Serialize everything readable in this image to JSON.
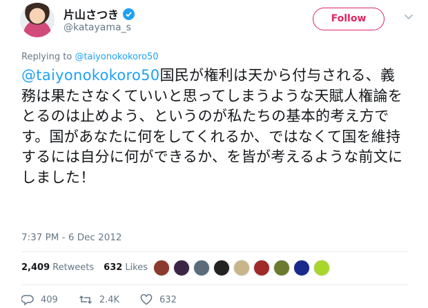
{
  "user": {
    "display_name": "片山さつき",
    "handle": "@katayama_s",
    "verified": true
  },
  "follow_button": {
    "label": "Follow",
    "color": "#e0245e"
  },
  "tweet": {
    "reply_prefix": "Replying to",
    "reply_to": "@taiyonokokoro50",
    "mention": "@taiyonokokoro50",
    "body": "国民が権利は天から付与される、義務は果たさなくていいと思ってしまうような天賦人権論をとるのは止めよう、というのが私たちの基本的考え方です。国があなたに何をしてくれるか、ではなくて国を維持するには自分に何ができるか、を皆が考えるような前文にしました！",
    "timestamp": "7:37 PM - 6 Dec 2012"
  },
  "stats": {
    "retweets_count": "2,409",
    "retweets_label": "Retweets",
    "likes_count": "632",
    "likes_label": "Likes"
  },
  "likers": [
    {
      "icon": "avatar-icon",
      "color": "#8b3a2e"
    },
    {
      "icon": "avatar-icon",
      "color": "#3b2545"
    },
    {
      "icon": "avatar-icon",
      "color": "#5a6b7a"
    },
    {
      "icon": "avatar-icon",
      "color": "#222222"
    },
    {
      "icon": "avatar-icon",
      "color": "#c9b58a"
    },
    {
      "icon": "avatar-icon",
      "color": "#a02a2a"
    },
    {
      "icon": "avatar-icon",
      "color": "#6b7a2e"
    },
    {
      "icon": "avatar-icon",
      "color": "#1a2a8a"
    },
    {
      "icon": "avatar-icon",
      "color": "#a8d62a"
    }
  ],
  "actions": {
    "reply_count": "409",
    "retweet_count": "2.4K",
    "like_count": "632"
  },
  "colors": {
    "accent": "#1da1f2",
    "text": "#14171a",
    "secondary": "#657786",
    "follow": "#e0245e"
  }
}
